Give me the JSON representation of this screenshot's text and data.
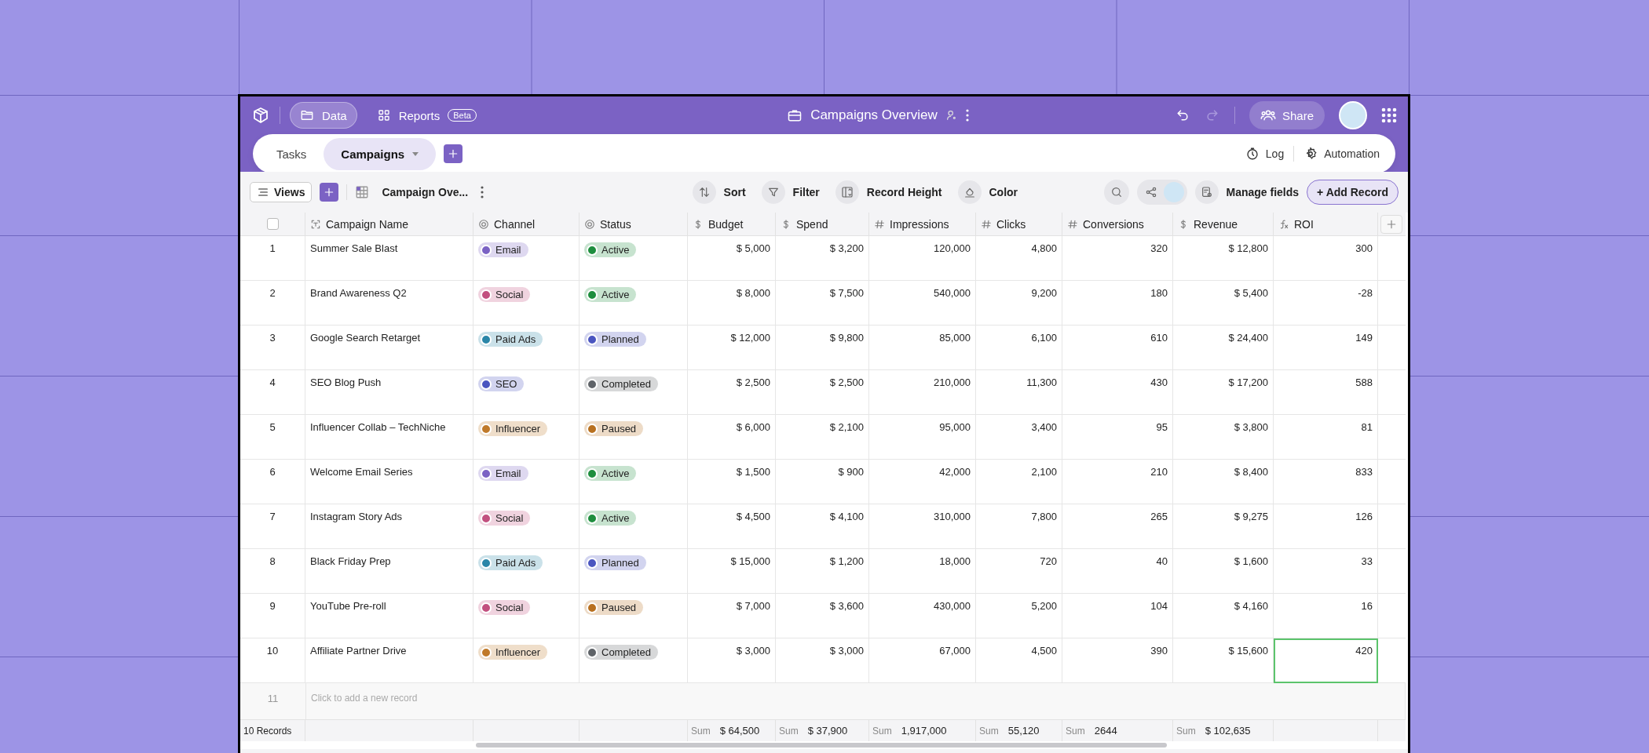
{
  "header": {
    "nav": [
      {
        "label": "Data",
        "selected": true
      },
      {
        "label": "Reports",
        "badge": "Beta",
        "selected": false
      }
    ],
    "title": "Campaigns Overview",
    "share": "Share"
  },
  "tabs": [
    {
      "label": "Tasks",
      "selected": false
    },
    {
      "label": "Campaigns",
      "selected": true
    }
  ],
  "tab_actions": [
    "Log",
    "Automation"
  ],
  "toolbar": {
    "views": "Views",
    "view_name": "Campaign Ove...",
    "tools": [
      "Sort",
      "Filter",
      "Record Height",
      "Color"
    ],
    "manage": "Manage fields",
    "add": "+ Add Record"
  },
  "table": {
    "select_all": {
      "checked": false
    },
    "columns": [
      {
        "label": "Campaign Name",
        "kind": "text"
      },
      {
        "label": "Channel",
        "kind": "select"
      },
      {
        "label": "Status",
        "kind": "select"
      },
      {
        "label": "Budget",
        "kind": "currency"
      },
      {
        "label": "Spend",
        "kind": "currency"
      },
      {
        "label": "Impressions",
        "kind": "number"
      },
      {
        "label": "Clicks",
        "kind": "number"
      },
      {
        "label": "Conversions",
        "kind": "number"
      },
      {
        "label": "Revenue",
        "kind": "currency"
      },
      {
        "label": "ROI",
        "kind": "formula"
      }
    ],
    "rows": [
      {
        "number": "1",
        "name": "Summer Sale Blast",
        "channel": {
          "label": "Email",
          "color": "#7b62c4"
        },
        "status": {
          "label": "Active",
          "color": "#1e8e3e"
        },
        "values": [
          "$ 5,000",
          "$ 3,200",
          "120,000",
          "4,800",
          "320",
          "$ 12,800",
          "300"
        ],
        "roi_focused": false
      },
      {
        "number": "2",
        "name": "Brand Awareness Q2",
        "channel": {
          "label": "Social",
          "color": "#c2507f"
        },
        "status": {
          "label": "Active",
          "color": "#1e8e3e"
        },
        "values": [
          "$ 8,000",
          "$ 7,500",
          "540,000",
          "9,200",
          "180",
          "$ 5,400",
          "-28"
        ],
        "roi_focused": false
      },
      {
        "number": "3",
        "name": "Google Search Retarget",
        "channel": {
          "label": "Paid Ads",
          "color": "#2a86a8"
        },
        "status": {
          "label": "Planned",
          "color": "#4a55c0"
        },
        "values": [
          "$ 12,000",
          "$ 9,800",
          "85,000",
          "6,100",
          "610",
          "$ 24,400",
          "149"
        ],
        "roi_focused": false
      },
      {
        "number": "4",
        "name": "SEO Blog Push",
        "channel": {
          "label": "SEO",
          "color": "#4a55c0"
        },
        "status": {
          "label": "Completed",
          "color": "#5f6368"
        },
        "values": [
          "$ 2,500",
          "$ 2,500",
          "210,000",
          "11,300",
          "430",
          "$ 17,200",
          "588"
        ],
        "roi_focused": false
      },
      {
        "number": "5",
        "name": "Influencer Collab – TechNiche",
        "channel": {
          "label": "Influencer",
          "color": "#c07a2a"
        },
        "status": {
          "label": "Paused",
          "color": "#b8701f"
        },
        "values": [
          "$ 6,000",
          "$ 2,100",
          "95,000",
          "3,400",
          "95",
          "$ 3,800",
          "81"
        ],
        "roi_focused": false
      },
      {
        "number": "6",
        "name": "Welcome Email Series",
        "channel": {
          "label": "Email",
          "color": "#7b62c4"
        },
        "status": {
          "label": "Active",
          "color": "#1e8e3e"
        },
        "values": [
          "$ 1,500",
          "$ 900",
          "42,000",
          "2,100",
          "210",
          "$ 8,400",
          "833"
        ],
        "roi_focused": false
      },
      {
        "number": "7",
        "name": "Instagram Story Ads",
        "channel": {
          "label": "Social",
          "color": "#c2507f"
        },
        "status": {
          "label": "Active",
          "color": "#1e8e3e"
        },
        "values": [
          "$ 4,500",
          "$ 4,100",
          "310,000",
          "7,800",
          "265",
          "$ 9,275",
          "126"
        ],
        "roi_focused": false
      },
      {
        "number": "8",
        "name": "Black Friday Prep",
        "channel": {
          "label": "Paid Ads",
          "color": "#2a86a8"
        },
        "status": {
          "label": "Planned",
          "color": "#4a55c0"
        },
        "values": [
          "$ 15,000",
          "$ 1,200",
          "18,000",
          "720",
          "40",
          "$ 1,600",
          "33"
        ],
        "roi_focused": false
      },
      {
        "number": "9",
        "name": "YouTube Pre-roll",
        "channel": {
          "label": "Social",
          "color": "#c2507f"
        },
        "status": {
          "label": "Paused",
          "color": "#b8701f"
        },
        "values": [
          "$ 7,000",
          "$ 3,600",
          "430,000",
          "5,200",
          "104",
          "$ 4,160",
          "16"
        ],
        "roi_focused": false
      },
      {
        "number": "10",
        "name": "Affiliate Partner Drive",
        "channel": {
          "label": "Influencer",
          "color": "#c07a2a"
        },
        "status": {
          "label": "Completed",
          "color": "#5f6368"
        },
        "values": [
          "$ 3,000",
          "$ 3,000",
          "67,000",
          "4,500",
          "390",
          "$ 15,600",
          "420"
        ],
        "roi_focused": true
      }
    ],
    "new_row": {
      "number": "11",
      "placeholder": "Click to add a new record"
    },
    "footer": {
      "count": "10 Records",
      "sums": [
        {
          "label": "Sum",
          "value": "$ 64,500"
        },
        {
          "label": "Sum",
          "value": "$ 37,900"
        },
        {
          "label": "Sum",
          "value": "1,917,000"
        },
        {
          "label": "Sum",
          "value": "55,120"
        },
        {
          "label": "Sum",
          "value": "2644"
        },
        {
          "label": "Sum",
          "value": "$ 102,635"
        }
      ]
    }
  }
}
